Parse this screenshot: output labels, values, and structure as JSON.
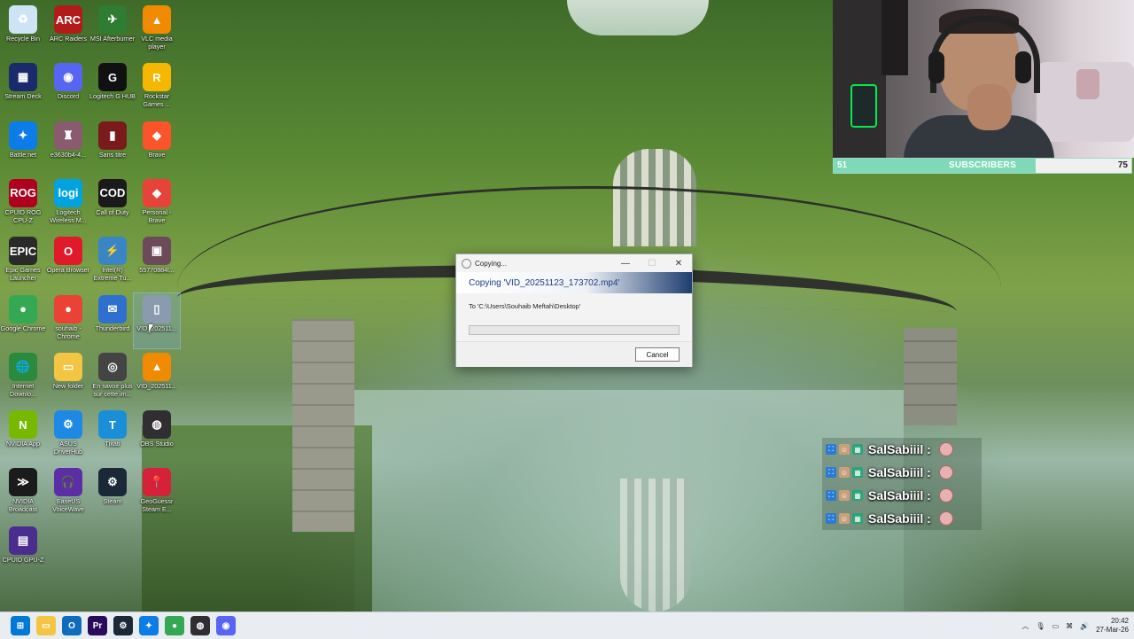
{
  "desktop": {
    "icons": [
      {
        "label": "Recycle Bin",
        "icon": "recycle-bin-icon",
        "color": "#cfe3f7",
        "glyph": "♻"
      },
      {
        "label": "ARC Raiders",
        "icon": "arc-raiders-icon",
        "color": "#b31b1b",
        "glyph": "ARC"
      },
      {
        "label": "MSI Afterburner",
        "icon": "msi-afterburner-icon",
        "color": "#2e7d32",
        "glyph": "✈"
      },
      {
        "label": "VLC media player",
        "icon": "vlc-icon",
        "color": "#f08a00",
        "glyph": "▲"
      },
      {
        "label": "Stream Deck",
        "icon": "stream-deck-icon",
        "color": "#1b2a6b",
        "glyph": "▦"
      },
      {
        "label": "Discord",
        "icon": "discord-icon",
        "color": "#5865f2",
        "glyph": "◉"
      },
      {
        "label": "Logitech G HUB",
        "icon": "logitech-g-hub-icon",
        "color": "#111111",
        "glyph": "G"
      },
      {
        "label": "Rockstar Games ...",
        "icon": "rockstar-icon",
        "color": "#f5b700",
        "glyph": "R"
      },
      {
        "label": "Battle.net",
        "icon": "battle-net-icon",
        "color": "#0c7ce8",
        "glyph": "✦"
      },
      {
        "label": "e3630b4-4...",
        "icon": "file-icon",
        "color": "#8a5a6e",
        "glyph": "♜"
      },
      {
        "label": "Sans titre",
        "icon": "image-icon",
        "color": "#7a1a1a",
        "glyph": "▮"
      },
      {
        "label": "Brave",
        "icon": "brave-icon",
        "color": "#fb542b",
        "glyph": "◆"
      },
      {
        "label": "CPUID ROG CPU-Z",
        "icon": "cpuz-rog-icon",
        "color": "#b00020",
        "glyph": "ROG"
      },
      {
        "label": "Logitech Wireless M...",
        "icon": "logi-icon",
        "color": "#00a3e0",
        "glyph": "logi"
      },
      {
        "label": "Call of Duty",
        "icon": "call-of-duty-icon",
        "color": "#1a1a1a",
        "glyph": "COD"
      },
      {
        "label": "Personal - Brave",
        "icon": "brave-profile-icon",
        "color": "#e8433a",
        "glyph": "◆"
      },
      {
        "label": "Epic Games Launcher",
        "icon": "epic-games-icon",
        "color": "#2a2a2a",
        "glyph": "EPIC"
      },
      {
        "label": "Opera Browser",
        "icon": "opera-icon",
        "color": "#e01a2b",
        "glyph": "O"
      },
      {
        "label": "Intel(R) Extreme Tu...",
        "icon": "intel-xtu-icon",
        "color": "#3a85c6",
        "glyph": "⚡"
      },
      {
        "label": "55770884l...",
        "icon": "photo-icon",
        "color": "#6c4a5a",
        "glyph": "▣"
      },
      {
        "label": "Google Chrome",
        "icon": "chrome-icon",
        "color": "#34a853",
        "glyph": "●"
      },
      {
        "label": "souhaib - Chrome",
        "icon": "chrome-profile-icon",
        "color": "#ea4335",
        "glyph": "●"
      },
      {
        "label": "Thunderbird",
        "icon": "thunderbird-icon",
        "color": "#2f6fcf",
        "glyph": "✉"
      },
      {
        "label": "VID_202511...",
        "icon": "video-file-icon",
        "color": "#8a9bb0",
        "glyph": "▯"
      },
      {
        "label": "Internet Downlo...",
        "icon": "idm-icon",
        "color": "#2a8a3e",
        "glyph": "🌐"
      },
      {
        "label": "New folder",
        "icon": "folder-icon",
        "color": "#f4c542",
        "glyph": "▭"
      },
      {
        "label": "En savoir plus sur cette im...",
        "icon": "learn-more-icon",
        "color": "#444444",
        "glyph": "◎"
      },
      {
        "label": "VID_202511...",
        "icon": "vlc-video-icon",
        "color": "#f08a00",
        "glyph": "▲"
      },
      {
        "label": "NVIDIA App",
        "icon": "nvidia-app-icon",
        "color": "#76b900",
        "glyph": "N"
      },
      {
        "label": "ASUS DriverHub",
        "icon": "asus-driverhub-icon",
        "color": "#1e88e5",
        "glyph": "⚙"
      },
      {
        "label": "Tixati",
        "icon": "tixati-icon",
        "color": "#1a8fd8",
        "glyph": "T"
      },
      {
        "label": "OBS Studio",
        "icon": "obs-icon",
        "color": "#302e31",
        "glyph": "◍"
      },
      {
        "label": "NVIDIA Broadcast",
        "icon": "nvidia-broadcast-icon",
        "color": "#1b1b1b",
        "glyph": "≫"
      },
      {
        "label": "EaseUS VoiceWave",
        "icon": "easeus-voicewave-icon",
        "color": "#5b2ea6",
        "glyph": "🎧"
      },
      {
        "label": "Steam",
        "icon": "steam-icon",
        "color": "#1b2838",
        "glyph": "⚙"
      },
      {
        "label": "GeoGuessr Steam E...",
        "icon": "geoguessr-icon",
        "color": "#d6213a",
        "glyph": "📍"
      },
      {
        "label": "CPUID GPU-Z",
        "icon": "gpuz-icon",
        "color": "#4b2c8f",
        "glyph": "▤"
      }
    ]
  },
  "webcam": {
    "subscribers": {
      "left": "51",
      "label": "SUBSCRIBERS",
      "right": "75",
      "progress": 0.68,
      "accent": "#7fd9b8"
    }
  },
  "chat": {
    "messages": [
      {
        "user": "SalSabiiil :"
      },
      {
        "user": "SalSabiiil :"
      },
      {
        "user": "SalSabiiil :"
      },
      {
        "user": "SalSabiiil :"
      }
    ]
  },
  "copy_dialog": {
    "title": "Copying...",
    "heading": "Copying 'VID_20251123_173702.mp4'",
    "destination": "To 'C:\\Users\\Souhaib Meftah\\Desktop'",
    "progress": 0.0,
    "cancel_label": "Cancel",
    "minimize_glyph": "—",
    "maximize_glyph": "☐",
    "close_glyph": "✕"
  },
  "taskbar": {
    "apps": [
      {
        "icon": "start-icon",
        "color": "#0078d4",
        "glyph": "⊞"
      },
      {
        "icon": "file-explorer-icon",
        "color": "#f4c542",
        "glyph": "▭"
      },
      {
        "icon": "outlook-icon",
        "color": "#0f6cbd",
        "glyph": "O"
      },
      {
        "icon": "premiere-pro-icon",
        "color": "#2a0a5a",
        "glyph": "Pr"
      },
      {
        "icon": "steam-taskbar-icon",
        "color": "#1b2838",
        "glyph": "⚙"
      },
      {
        "icon": "battle-net-taskbar-icon",
        "color": "#0c7ce8",
        "glyph": "✦"
      },
      {
        "icon": "chrome-taskbar-icon",
        "color": "#34a853",
        "glyph": "●"
      },
      {
        "icon": "obs-taskbar-icon",
        "color": "#302e31",
        "glyph": "◍"
      },
      {
        "icon": "discord-taskbar-icon",
        "color": "#5865f2",
        "glyph": "◉"
      }
    ],
    "tray": {
      "time": "20:42",
      "date": "27-Mar-26"
    }
  }
}
